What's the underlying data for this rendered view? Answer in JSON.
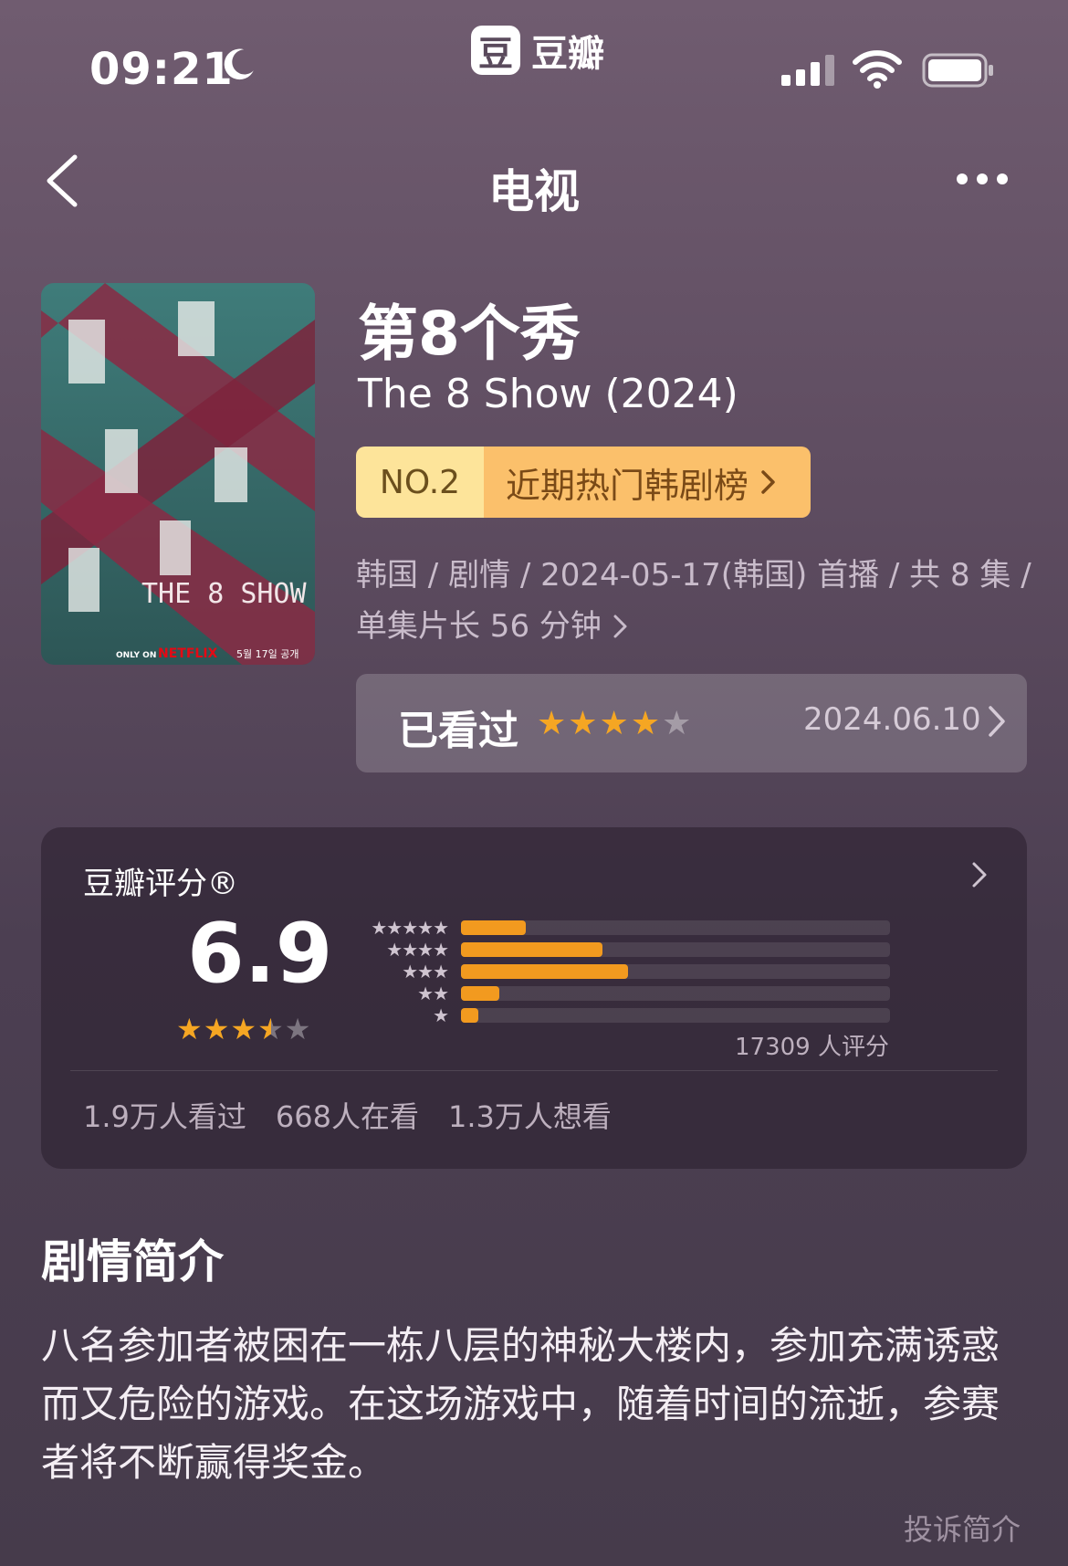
{
  "status_bar": {
    "time": "09:21",
    "app_name": "豆瓣",
    "app_logo_char": "豆"
  },
  "nav": {
    "title": "电视"
  },
  "movie": {
    "title": "第8个秀",
    "subtitle": "The 8 Show (2024)",
    "rank_no": "NO.2",
    "rank_label": "近期热门韩剧榜",
    "meta_line1": "韩国 / 剧情 / 2024-05-17(韩国) 首播 / 共 8 集 /",
    "meta_line2": "单集片长 56 分钟"
  },
  "watched": {
    "label": "已看过",
    "stars": 4,
    "date": "2024.06.10"
  },
  "rating": {
    "header": "豆瓣评分®",
    "score": "6.9",
    "score_stars": 3.5,
    "distribution": [
      15,
      33,
      39,
      9,
      4
    ],
    "count_text": "17309 人评分",
    "stats": [
      "1.9万人看过",
      "668人在看",
      "1.3万人想看"
    ]
  },
  "synopsis": {
    "title": "剧情简介",
    "text": "八名参加者被困在一栋八层的神秘大楼内，参加充满诱惑而又危险的游戏。在这场游戏中，随着时间的流逝，参赛者将不断赢得奖金。",
    "report": "投诉简介"
  },
  "poster": {
    "texts": [
      "THE 8 SHOW",
      "ONLY ON",
      "NETFLIX",
      "5월 17일 공개"
    ]
  }
}
